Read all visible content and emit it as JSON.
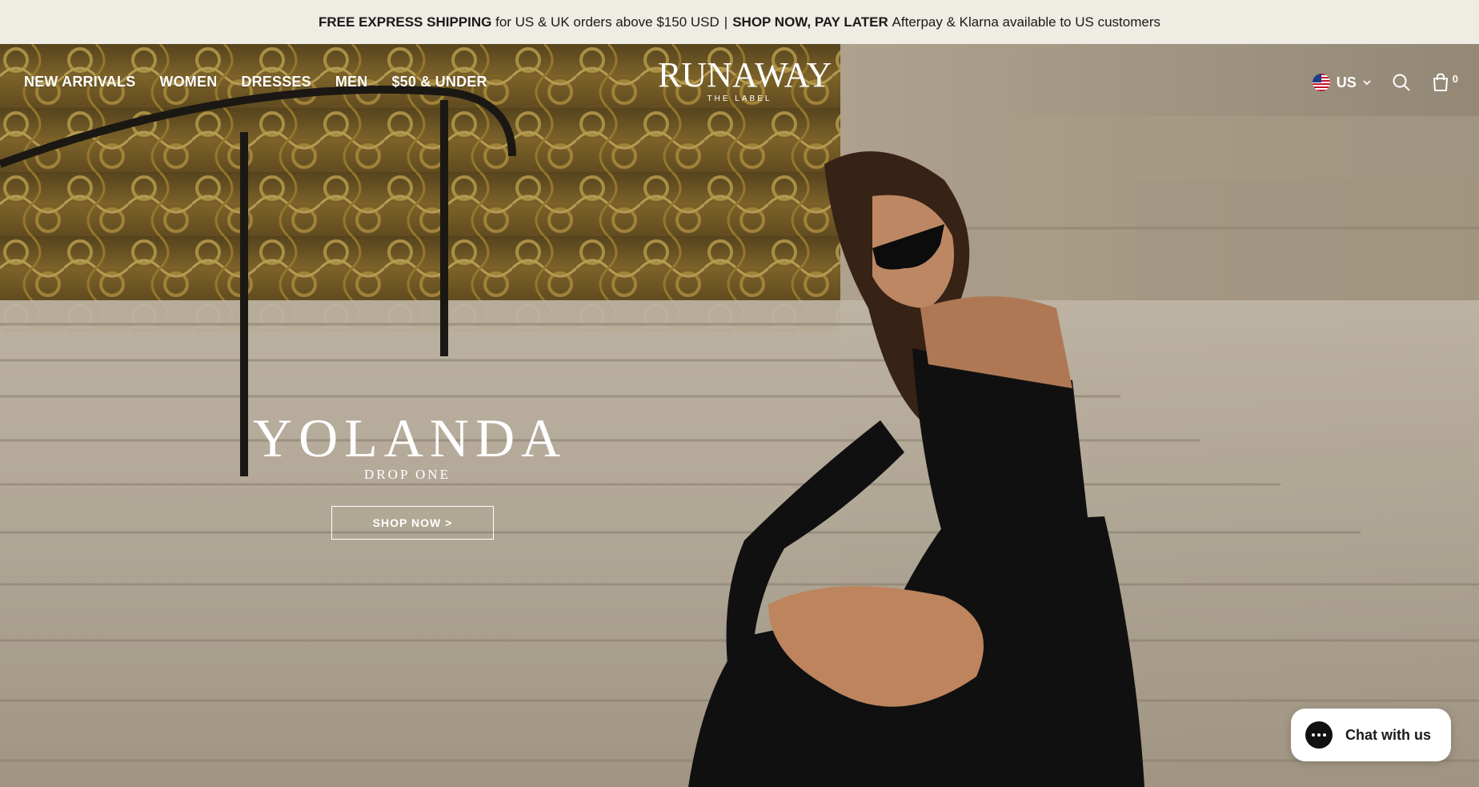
{
  "announcement": {
    "part1_bold": "FREE EXPRESS SHIPPING",
    "part1_text": "for US & UK orders above $150 USD",
    "separator": "|",
    "part2_bold": "SHOP NOW, PAY LATER",
    "part2_text": "Afterpay & Klarna available to US customers"
  },
  "nav": {
    "items": [
      {
        "label": "NEW ARRIVALS"
      },
      {
        "label": "WOMEN"
      },
      {
        "label": "DRESSES"
      },
      {
        "label": "MEN"
      },
      {
        "label": "$50 & UNDER"
      }
    ]
  },
  "logo": {
    "brand": "RUNAWAY",
    "tagline": "THE LABEL"
  },
  "tools": {
    "country": "US",
    "cart_count": "0",
    "icons": [
      "us-flag-icon",
      "chevron-down-icon",
      "search-icon",
      "shopping-bag-icon"
    ]
  },
  "hero": {
    "title": "YOLANDA",
    "subtitle": "DROP ONE",
    "cta": "SHOP NOW >"
  },
  "chat": {
    "label": "Chat with us"
  },
  "colors": {
    "announcement_bg": "#efece4",
    "text_dark": "#1a1a1a",
    "overlay_text": "#ffffff",
    "gold_gate": "#b08a3a"
  }
}
